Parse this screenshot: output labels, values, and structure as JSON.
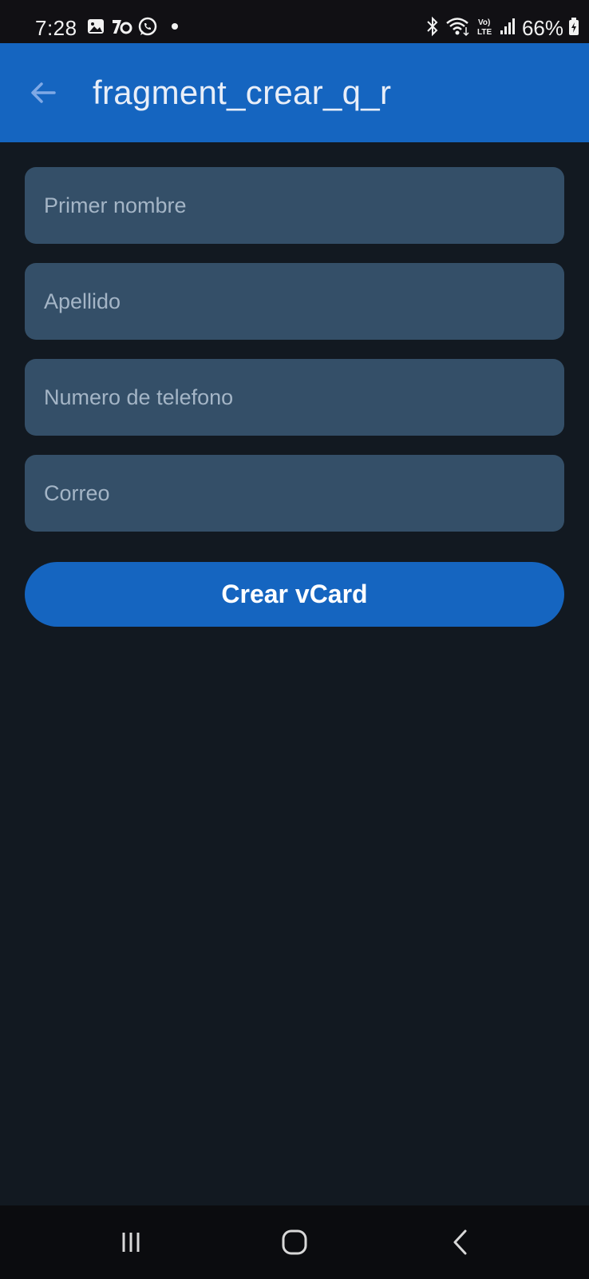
{
  "status_bar": {
    "time": "7:28",
    "battery": "66%",
    "icons": [
      "gallery-icon",
      "app-notification-icon",
      "whatsapp-icon",
      "dot-icon",
      "bluetooth-icon",
      "wifi-icon",
      "volte-icon",
      "signal-icon",
      "battery-icon"
    ]
  },
  "app_bar": {
    "title": "fragment_crear_q_r",
    "back_icon": "arrow-back-icon"
  },
  "form": {
    "first_name_placeholder": "Primer nombre",
    "last_name_placeholder": "Apellido",
    "phone_placeholder": "Numero de telefono",
    "email_placeholder": "Correo",
    "submit_label": "Crear vCard"
  },
  "nav_bar": {
    "icons": [
      "recent-apps-icon",
      "home-icon",
      "back-icon"
    ]
  },
  "colors": {
    "accent": "#1565c0",
    "field_background": "#344f68",
    "page_background": "#121921"
  }
}
